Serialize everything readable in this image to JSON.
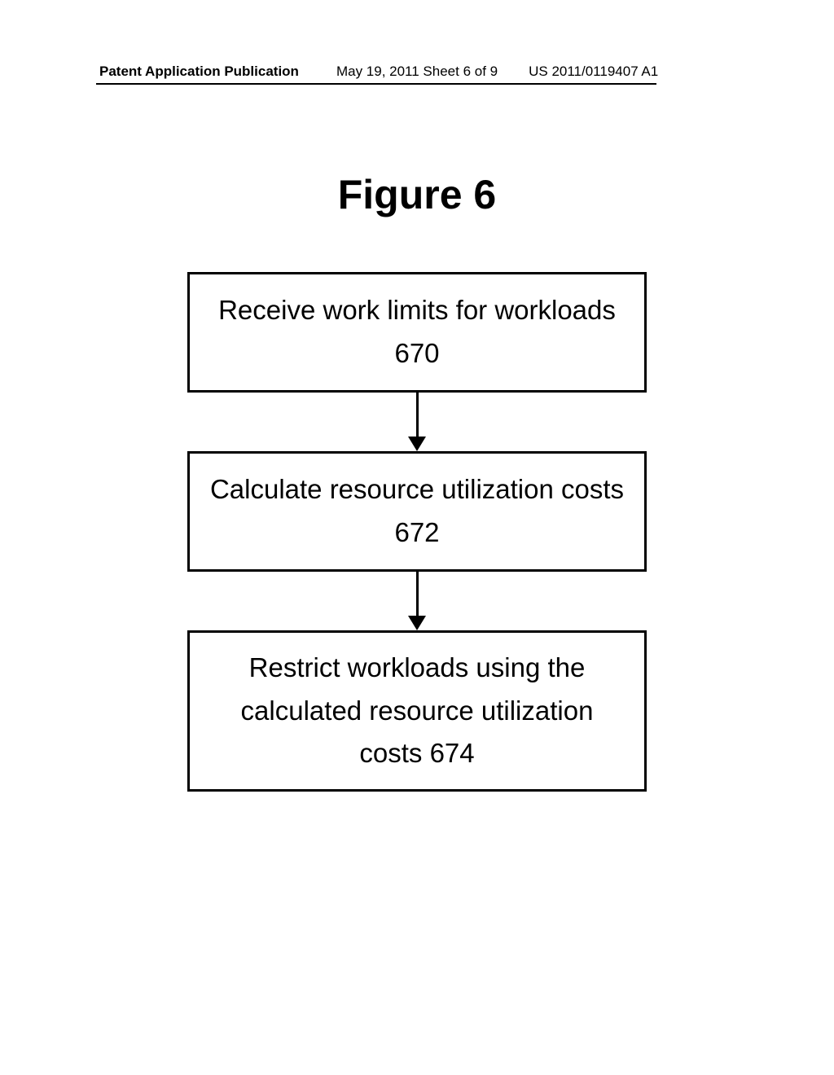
{
  "header": {
    "left": "Patent Application Publication",
    "center": "May 19, 2011  Sheet 6 of 9",
    "right": "US 2011/0119407 A1"
  },
  "figure_title": "Figure 6",
  "chart_data": {
    "type": "flowchart",
    "nodes": [
      {
        "id": "670",
        "text": "Receive work limits for workloads 670"
      },
      {
        "id": "672",
        "text": "Calculate resource utilization costs 672"
      },
      {
        "id": "674",
        "text": "Restrict workloads using the calculated resource utilization costs 674"
      }
    ],
    "edges": [
      {
        "from": "670",
        "to": "672"
      },
      {
        "from": "672",
        "to": "674"
      }
    ]
  }
}
